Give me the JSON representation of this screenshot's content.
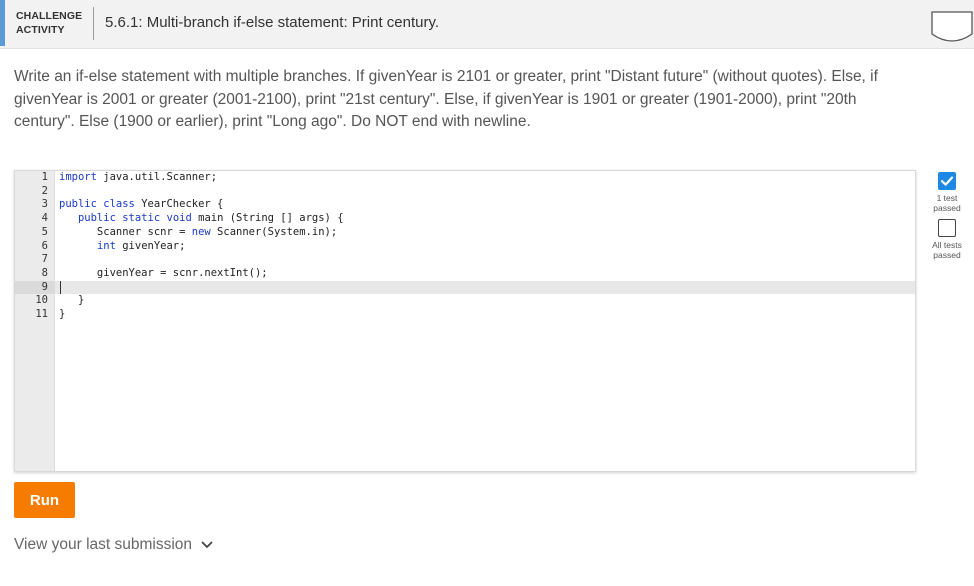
{
  "header": {
    "badge_line1": "CHALLENGE",
    "badge_line2": "ACTIVITY",
    "title": "5.6.1: Multi-branch if-else statement: Print century."
  },
  "instructions": "Write an if-else statement with multiple branches. If givenYear is 2101 or greater, print \"Distant future\" (without quotes). Else, if givenYear is 2001 or greater (2001-2100), print \"21st century\". Else, if givenYear is 1901 or greater (1901-2000), print \"20th century\". Else (1900 or earlier), print \"Long ago\". Do NOT end with newline.",
  "editor": {
    "active_line": 9,
    "lines": [
      {
        "num": "1",
        "text": "import java.util.Scanner;"
      },
      {
        "num": "2",
        "text": ""
      },
      {
        "num": "3",
        "text": "public class YearChecker {"
      },
      {
        "num": "4",
        "text": "   public static void main (String [] args) {"
      },
      {
        "num": "5",
        "text": "      Scanner scnr = new Scanner(System.in);"
      },
      {
        "num": "6",
        "text": "      int givenYear;"
      },
      {
        "num": "7",
        "text": ""
      },
      {
        "num": "8",
        "text": "      givenYear = scnr.nextInt();"
      },
      {
        "num": "9",
        "text": ""
      },
      {
        "num": "10",
        "text": "   }"
      },
      {
        "num": "11",
        "text": "}"
      }
    ]
  },
  "tests": {
    "test1_label_line1": "1 test",
    "test1_label_line2": "passed",
    "test2_label_line1": "All tests",
    "test2_label_line2": "passed"
  },
  "run_button": {
    "label": "Run"
  },
  "last_submission": {
    "label": "View your last submission"
  },
  "colors": {
    "accent": "#5b9bd5",
    "run_button": "#f57c00",
    "check": "#1e88e5",
    "keyword": "#1a39c7"
  },
  "icons": {
    "header_status": "shield-icon",
    "test1": "checkmark-icon",
    "test2": "empty-checkbox-icon",
    "expand": "chevron-down-icon"
  }
}
